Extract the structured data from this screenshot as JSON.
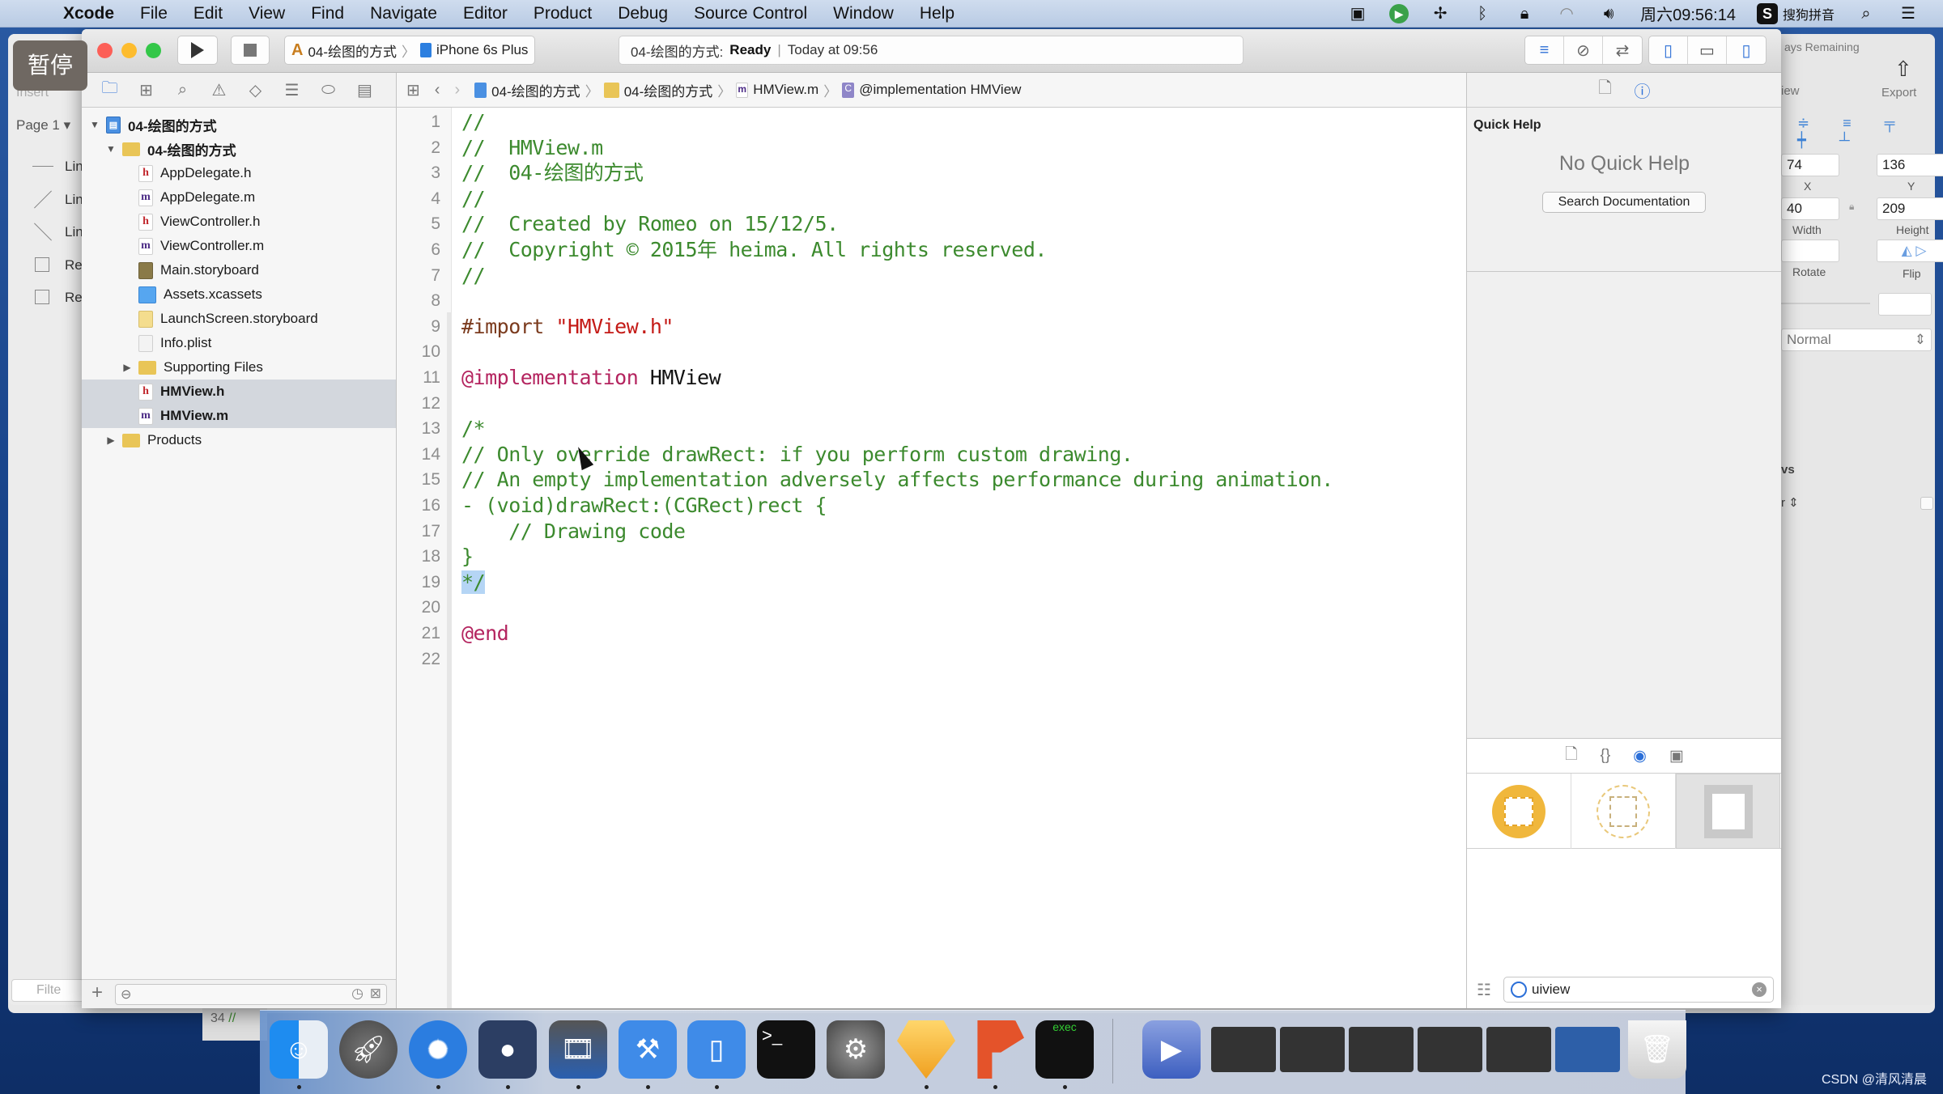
{
  "menubar": {
    "items": [
      "Xcode",
      "File",
      "Edit",
      "View",
      "Find",
      "Navigate",
      "Editor",
      "Product",
      "Debug",
      "Source Control",
      "Window",
      "Help"
    ],
    "clock": "周六09:56:14",
    "input_method": "搜狗拼音",
    "status_icons": [
      "screen-record-icon",
      "green-app-icon",
      "airplane-fan-icon",
      "bluetooth-icon",
      "lock-icon",
      "wifi-icon",
      "volume-icon",
      "sogou-icon",
      "spotlight-icon",
      "notification-center-icon"
    ]
  },
  "overlay": {
    "pause_label": "暂停"
  },
  "background_app": {
    "insert_label": "Insert",
    "page_label": "Page 1",
    "layers": [
      "Lin",
      "Lin",
      "Lin",
      "Re",
      "Re"
    ],
    "days_remaining": "ays Remaining",
    "view_label": "iew",
    "export_label": "Export",
    "x_value": "74",
    "y_value": "136",
    "width_value": "40",
    "height_value": "209",
    "x_label": "X",
    "y_label": "Y",
    "width_label": "Width",
    "height_label": "Height",
    "rotate_label": "Rotate",
    "flip_label": "Flip",
    "blend_mode": "Normal",
    "section_fragment": "vs",
    "row_fragment": "r",
    "filter_placeholder": "Filte",
    "behind_line_number": "34"
  },
  "toolbar": {
    "scheme_name": "04-绘图的方式",
    "device": "iPhone 6s Plus",
    "activity_project": "04-绘图的方式:",
    "activity_status": "Ready",
    "activity_time": "Today at 09:56"
  },
  "jumpbar": {
    "crumbs": [
      "04-绘图的方式",
      "04-绘图的方式",
      "HMView.m",
      "@implementation HMView"
    ]
  },
  "navigator": {
    "tree": [
      {
        "label": "04-绘图的方式",
        "type": "project",
        "disclosure": "open",
        "depth": 0
      },
      {
        "label": "04-绘图的方式",
        "type": "folder",
        "disclosure": "open",
        "depth": 1
      },
      {
        "label": "AppDelegate.h",
        "type": "h",
        "depth": 2
      },
      {
        "label": "AppDelegate.m",
        "type": "m",
        "depth": 2
      },
      {
        "label": "ViewController.h",
        "type": "h",
        "depth": 2
      },
      {
        "label": "ViewController.m",
        "type": "m",
        "depth": 2
      },
      {
        "label": "Main.storyboard",
        "type": "storyboard",
        "depth": 2
      },
      {
        "label": "Assets.xcassets",
        "type": "assets",
        "depth": 2
      },
      {
        "label": "LaunchScreen.storyboard",
        "type": "launch",
        "depth": 2
      },
      {
        "label": "Info.plist",
        "type": "plist",
        "depth": 2
      },
      {
        "label": "Supporting Files",
        "type": "folder",
        "disclosure": "closed",
        "depth": 2
      },
      {
        "label": "HMView.h",
        "type": "h",
        "depth": 2,
        "selected": true
      },
      {
        "label": "HMView.m",
        "type": "m",
        "depth": 2,
        "selected": true
      },
      {
        "label": "Products",
        "type": "folder",
        "disclosure": "closed",
        "depth": 1
      }
    ]
  },
  "editor": {
    "lines": [
      [
        {
          "t": "//",
          "c": "comment"
        }
      ],
      [
        {
          "t": "//  HMView.m",
          "c": "comment"
        }
      ],
      [
        {
          "t": "//  04-绘图的方式",
          "c": "comment"
        }
      ],
      [
        {
          "t": "//",
          "c": "comment"
        }
      ],
      [
        {
          "t": "//  Created by Romeo on 15/12/5.",
          "c": "comment"
        }
      ],
      [
        {
          "t": "//  Copyright © 2015年 heima. All rights reserved.",
          "c": "comment"
        }
      ],
      [
        {
          "t": "//",
          "c": "comment"
        }
      ],
      [],
      [
        {
          "t": "#import ",
          "c": "pre"
        },
        {
          "t": "\"HMView.h\"",
          "c": "str"
        }
      ],
      [],
      [
        {
          "t": "@implementation",
          "c": "kw"
        },
        {
          "t": " HMView",
          "c": "plain"
        }
      ],
      [],
      [
        {
          "t": "/*",
          "c": "comment"
        }
      ],
      [
        {
          "t": "// Only override drawRect: if you perform custom drawing.",
          "c": "comment"
        }
      ],
      [
        {
          "t": "// An empty implementation adversely affects performance during animation.",
          "c": "comment"
        }
      ],
      [
        {
          "t": "- (void)drawRect:(CGRect)rect {",
          "c": "comment"
        }
      ],
      [
        {
          "t": "    // Drawing code",
          "c": "comment"
        }
      ],
      [
        {
          "t": "}",
          "c": "comment"
        }
      ],
      [
        {
          "t": "*/",
          "c": "comment sel"
        }
      ],
      [],
      [
        {
          "t": "@end",
          "c": "kw"
        }
      ],
      []
    ]
  },
  "utilities": {
    "quick_help_title": "Quick Help",
    "no_quick_help": "No Quick Help",
    "search_doc_button": "Search Documentation",
    "library_search_value": "uiview"
  },
  "dock": {
    "items": [
      "Finder",
      "Launchpad",
      "Safari",
      "Mouse",
      "Photo Booth",
      "Xcode",
      "Simulator",
      "Terminal",
      "System Preferences",
      "Sketch",
      "Keynote-P",
      "Console exec",
      "Windows Media",
      "Screenshot 1",
      "Screenshot 2",
      "Screenshot 3",
      "Screenshot 4",
      "Screenshot 5",
      "Screenshot 6",
      "Trash"
    ]
  },
  "watermark": "CSDN @清风清晨",
  "colors": {
    "comment": "#3c8a2e",
    "keyword": "#b4245f",
    "string": "#c41a16",
    "preprocessor": "#7b3b1e",
    "accent": "#2b6fd8",
    "selection": "#d3d7dd"
  }
}
